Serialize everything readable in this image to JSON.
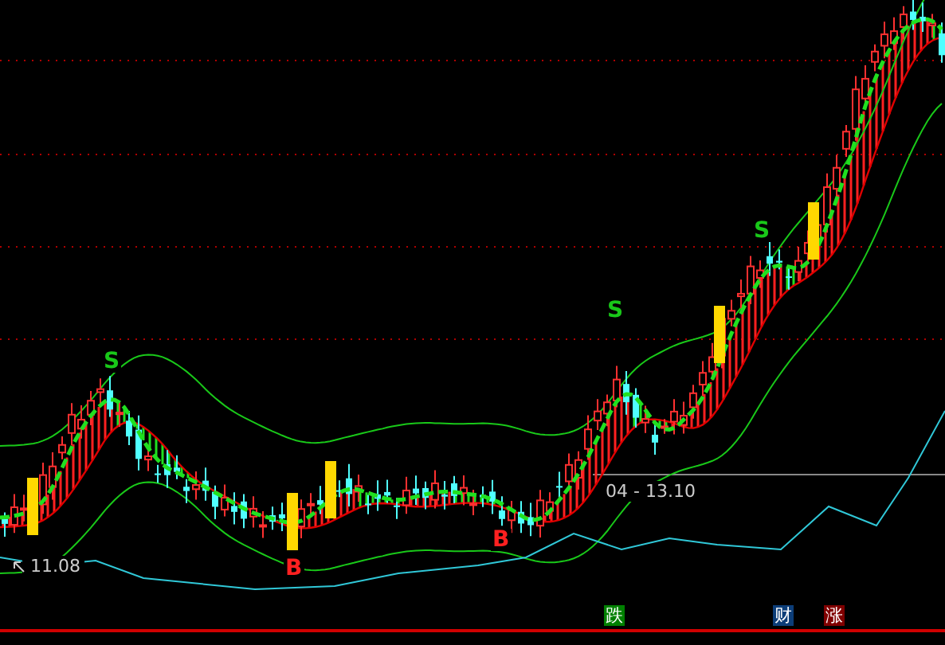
{
  "signals": [
    {
      "text": "S",
      "kind": "sell"
    },
    {
      "text": "B",
      "kind": "buy"
    },
    {
      "text": "B",
      "kind": "buy"
    },
    {
      "text": "S",
      "kind": "sell"
    },
    {
      "text": "S",
      "kind": "sell"
    }
  ],
  "price_labels": [
    {
      "text": "11.08",
      "kind": "low"
    },
    {
      "text": "04 - 13.10",
      "kind": "high"
    }
  ],
  "badges": [
    {
      "text": "跌",
      "color": "#008000"
    },
    {
      "text": "财",
      "color": "#0c3d78"
    },
    {
      "text": "涨",
      "color": "#800000"
    }
  ]
}
